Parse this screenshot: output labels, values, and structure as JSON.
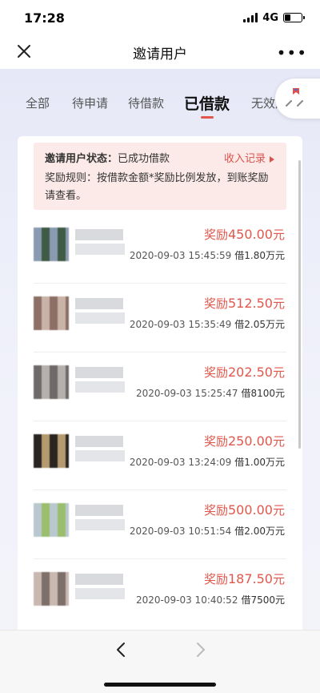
{
  "status": {
    "time": "17:28",
    "network": "4G"
  },
  "nav": {
    "title": "邀请用户"
  },
  "tabs": [
    {
      "label": "全部",
      "active": false
    },
    {
      "label": "待申请",
      "active": false
    },
    {
      "label": "待借款",
      "active": false
    },
    {
      "label": "已借款",
      "active": true
    },
    {
      "label": "无效用户",
      "active": false
    }
  ],
  "notice": {
    "status_label": "邀请用户状态：",
    "status_value": "已成功借款",
    "record_link": "收入记录",
    "rule": "奖励规则：按借款金额*奖励比例发放，到账奖励请查看。"
  },
  "records": [
    {
      "reward_prefix": "奖励",
      "reward_amount": "450.00",
      "reward_unit": "元",
      "datetime": "2020-09-03 15:45:59",
      "loan": "借1.80万元"
    },
    {
      "reward_prefix": "奖励",
      "reward_amount": "512.50",
      "reward_unit": "元",
      "datetime": "2020-09-03 15:35:49",
      "loan": "借2.05万元"
    },
    {
      "reward_prefix": "奖励",
      "reward_amount": "202.50",
      "reward_unit": "元",
      "datetime": "2020-09-03 15:25:47",
      "loan": "借8100元"
    },
    {
      "reward_prefix": "奖励",
      "reward_amount": "250.00",
      "reward_unit": "元",
      "datetime": "2020-09-03 13:24:09",
      "loan": "借1.00万元"
    },
    {
      "reward_prefix": "奖励",
      "reward_amount": "500.00",
      "reward_unit": "元",
      "datetime": "2020-09-03 10:51:54",
      "loan": "借2.00万元"
    },
    {
      "reward_prefix": "奖励",
      "reward_amount": "187.50",
      "reward_unit": "元",
      "datetime": "2020-09-03 10:40:52",
      "loan": "借7500元"
    }
  ],
  "colors": {
    "accent": "#e0574c",
    "notice_bg": "#fbeae7"
  }
}
